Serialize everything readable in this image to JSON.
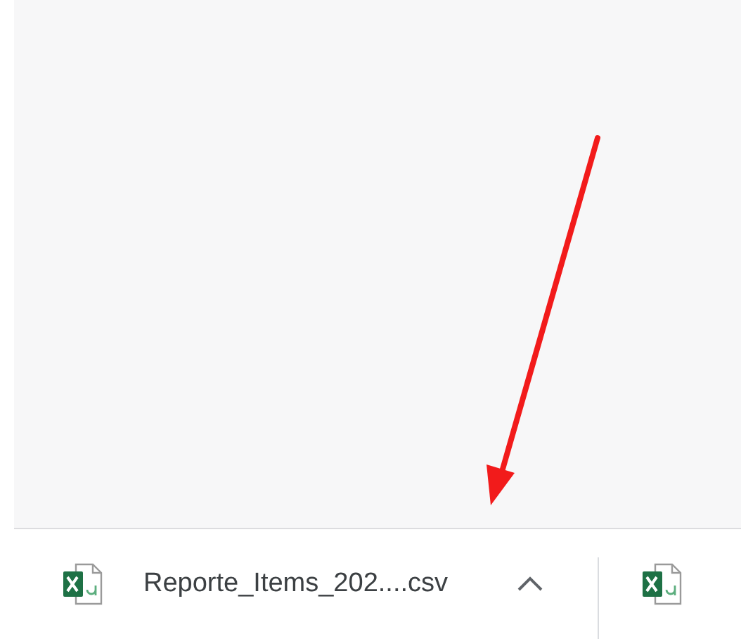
{
  "download_bar": {
    "items": [
      {
        "filename": "Reporte_Items_202....csv"
      }
    ]
  }
}
